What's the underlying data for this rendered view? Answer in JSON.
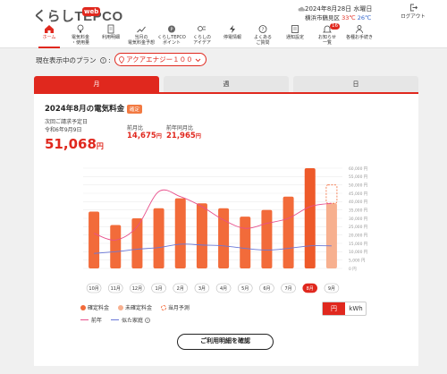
{
  "header": {
    "logo": "くらしTEPCO",
    "logo_badge": "web",
    "date": "2024年8月28日 水曜日",
    "location": "横浜市鶴見区",
    "temp_high": "33℃",
    "temp_low": "26℃",
    "logout": "ログアウト"
  },
  "nav": [
    {
      "label": "ホーム",
      "icon": "home-icon"
    },
    {
      "label": "電気料金\n・使用量",
      "icon": "bulb-icon"
    },
    {
      "label": "利用明細",
      "icon": "doc-icon"
    },
    {
      "label": "当月の\n電気料金予想",
      "icon": "trend-icon"
    },
    {
      "label": "くらしTEPCO\nポイント",
      "icon": "point-icon"
    },
    {
      "label": "くらしの\nアイデア",
      "icon": "idea-icon"
    },
    {
      "label": "停電情報",
      "icon": "bolt-icon"
    },
    {
      "label": "よくある\nご質問",
      "icon": "question-icon"
    },
    {
      "label": "通知設定",
      "icon": "settings-icon"
    },
    {
      "label": "お知らせ\n一覧",
      "icon": "bell-icon",
      "badge": "16"
    },
    {
      "label": "各種お手続き",
      "icon": "person-icon"
    }
  ],
  "plan": {
    "label": "現在表示中のプラン",
    "value": "アクアエナジー１００"
  },
  "tabs": [
    "月",
    "週",
    "日"
  ],
  "summary": {
    "title": "2024年8月の電気料金",
    "status": "確定",
    "schedule_label": "次回ご請求予定日",
    "schedule_date": "令和6年9月9日",
    "amount": "51,068",
    "amount_unit": "円",
    "prev_label": "前月比",
    "prev_value": "14,675",
    "ly_label": "前年同月比",
    "ly_value": "21,965",
    "yen": "円"
  },
  "chart_data": {
    "type": "bar",
    "categories": [
      "10月",
      "11月",
      "12月",
      "1月",
      "2月",
      "3月",
      "4月",
      "5月",
      "6月",
      "7月",
      "8月",
      "9月"
    ],
    "series": [
      {
        "name": "確定料金",
        "values": [
          34000,
          26000,
          30000,
          36000,
          42000,
          39000,
          36000,
          31000,
          35000,
          43000,
          60000,
          null
        ],
        "color": "#f26b3a"
      },
      {
        "name": "未確定料金",
        "values": [
          null,
          null,
          null,
          null,
          null,
          null,
          null,
          null,
          null,
          null,
          null,
          39000
        ],
        "color": "#f7b08f"
      },
      {
        "name": "当月予測",
        "values": [
          null,
          null,
          null,
          null,
          null,
          null,
          null,
          null,
          null,
          null,
          null,
          50000
        ],
        "color": "#f26b3a"
      },
      {
        "name": "前年",
        "type": "line",
        "values": [
          21000,
          17000,
          25000,
          46000,
          43000,
          37000,
          29000,
          24000,
          27000,
          30000,
          37000,
          39000
        ],
        "color": "#e8508c"
      },
      {
        "name": "似た家庭",
        "type": "line",
        "values": [
          9000,
          10000,
          11500,
          12500,
          14500,
          14000,
          13500,
          12000,
          11000,
          12000,
          13500,
          13500
        ],
        "color": "#6a78d8"
      }
    ],
    "yticks": [
      "60,000 円",
      "55,000 円",
      "50,000 円",
      "45,000 円",
      "40,000 円",
      "35,000 円",
      "30,000 円",
      "25,000 円",
      "20,000 円",
      "15,000 円",
      "10,000 円",
      "5,000 円",
      "0 円"
    ],
    "ylim": [
      0,
      60000
    ]
  },
  "legend": {
    "confirmed": "確定料金",
    "unconfirmed": "未確定料金",
    "forecast": "当月予測",
    "last_year": "前年",
    "similar": "似た家庭"
  },
  "unit_toggle": {
    "yen": "円",
    "kwh": "kWh"
  },
  "detail_button": "ご利用明細を確認"
}
